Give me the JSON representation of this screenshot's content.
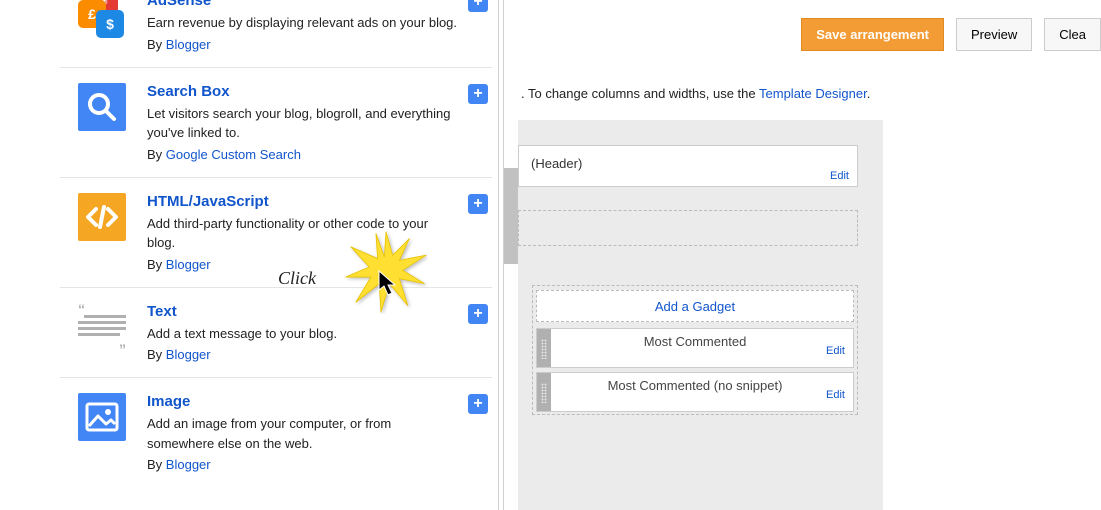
{
  "gadgets": [
    {
      "key": "adsense",
      "title": "AdSense",
      "desc": "Earn revenue by displaying relevant ads on your blog.",
      "by_prefix": "By ",
      "by_link": "Blogger"
    },
    {
      "key": "searchbox",
      "title": "Search Box",
      "desc": "Let visitors search your blog, blogroll, and everything you've linked to.",
      "by_prefix": "By ",
      "by_link": "Google Custom Search"
    },
    {
      "key": "htmljs",
      "title": "HTML/JavaScript",
      "desc": "Add third-party functionality or other code to your blog.",
      "by_prefix": "By ",
      "by_link": "Blogger"
    },
    {
      "key": "text",
      "title": "Text",
      "desc": "Add a text message to your blog.",
      "by_prefix": "By ",
      "by_link": "Blogger"
    },
    {
      "key": "image",
      "title": "Image",
      "desc": "Add an image from your computer, or from somewhere else on the web.",
      "by_prefix": "By ",
      "by_link": "Blogger"
    }
  ],
  "toolbar": {
    "save": "Save arrangement",
    "preview": "Preview",
    "clear": "Clea"
  },
  "info": {
    "prefix": ". To change columns and widths, use the ",
    "link": "Template Designer",
    "suffix": "."
  },
  "layout": {
    "header": "(Header)",
    "edit": "Edit",
    "add_gadget": "Add a Gadget",
    "widgets": [
      {
        "title": "Most Commented"
      },
      {
        "title": "Most Commented (no snippet)"
      }
    ]
  },
  "annotation": {
    "click_label": "Click"
  }
}
